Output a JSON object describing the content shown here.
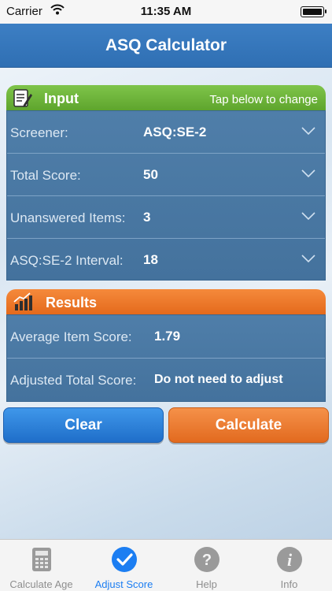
{
  "status_bar": {
    "carrier": "Carrier",
    "time": "11:35 AM"
  },
  "nav": {
    "title": "ASQ Calculator"
  },
  "input_section": {
    "title": "Input",
    "hint": "Tap below to change",
    "rows": [
      {
        "label": "Screener:",
        "value": "ASQ:SE-2"
      },
      {
        "label": "Total Score:",
        "value": "50"
      },
      {
        "label": "Unanswered Items:",
        "value": "3"
      },
      {
        "label": "ASQ:SE-2 Interval:",
        "value": "18"
      }
    ]
  },
  "results_section": {
    "title": "Results",
    "rows": [
      {
        "label": "Average Item Score:",
        "value": "1.79"
      },
      {
        "label": "Adjusted Total Score:",
        "value": "Do not need to adjust"
      }
    ]
  },
  "buttons": {
    "clear": "Clear",
    "calculate": "Calculate"
  },
  "tabs": [
    {
      "label": "Calculate Age",
      "icon": "calculator-icon"
    },
    {
      "label": "Adjust Score",
      "icon": "checkmark-icon",
      "active": true
    },
    {
      "label": "Help",
      "icon": "question-icon"
    },
    {
      "label": "Info",
      "icon": "info-icon"
    }
  ],
  "colors": {
    "nav": "#2f6fb3",
    "input_header": "#5ea52d",
    "results_header": "#e46a1c",
    "row_background": "#4a78a3",
    "clear_button": "#1f6ec9",
    "calculate_button": "#e26a1f",
    "tab_active": "#1c7ef2",
    "tab_inactive": "#8e8e8e"
  }
}
